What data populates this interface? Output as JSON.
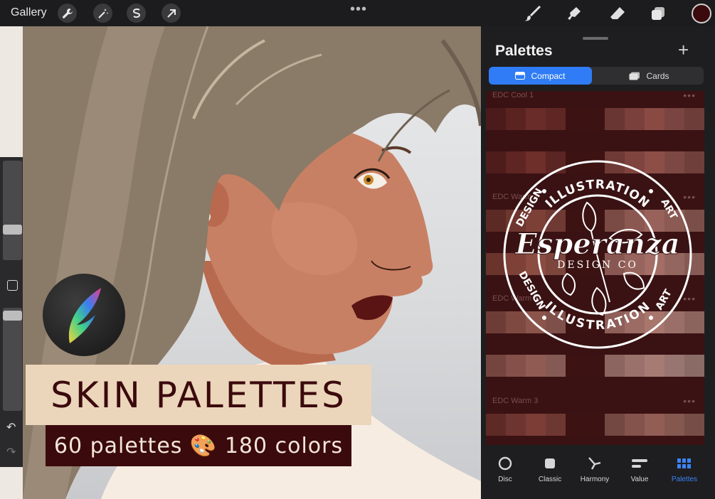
{
  "topbar": {
    "gallery_label": "Gallery",
    "more": "•••",
    "left_tools": [
      "wrench-icon",
      "magic-wand-icon",
      "selection-icon",
      "transform-arrow-icon"
    ],
    "right_tools": [
      "brush-icon",
      "smudge-icon",
      "eraser-icon",
      "layers-icon"
    ],
    "current_color": "#3a0a0c"
  },
  "canvas": {
    "headline": "SKIN PALETTES",
    "subline": "60 palettes 🎨 180 colors"
  },
  "panel": {
    "title": "Palettes",
    "add": "+",
    "view_modes": [
      {
        "label": "Compact",
        "active": true
      },
      {
        "label": "Cards",
        "active": false
      }
    ],
    "palettes": [
      {
        "name": "EDC Cool 1",
        "dots": "•••",
        "rows": [
          [
            "#4a1b1a",
            "#5a2320",
            "#6a2c28",
            "#5e2724",
            "#3c1312",
            "#3c1312",
            "#6a3633",
            "#7a403b",
            "#8a4a44",
            "#7a4540",
            "#6d3d39"
          ],
          [
            "#4d1c1b",
            "#5f2522",
            "#6e2e2a",
            "#5a2522",
            "#3c1312",
            "#3c1312",
            "#6f3a36",
            "#80443f",
            "#8d4e48",
            "#7d4843",
            "#6f3f3b"
          ]
        ]
      },
      {
        "name": "EDC Warm 2",
        "dots": "•••",
        "rows": [
          [
            "#5b2a25",
            "#6e362f",
            "#7c4036",
            "#6e3a33",
            "#3c1312",
            "#3c1312",
            "#7a4a44",
            "#8b5751",
            "#98625a",
            "#8a5a53",
            "#7b4f49"
          ],
          [
            "#6a342d",
            "#7d4138",
            "#8b4c41",
            "#7c463d",
            "#3c1312",
            "#3c1312",
            "#885751",
            "#98655e",
            "#a36e66",
            "#946660",
            "#865b55"
          ]
        ]
      },
      {
        "name": "EDC Warm 3",
        "dots": "•••",
        "rows": [
          [
            "#6e3c36",
            "#7e4940",
            "#8c554b",
            "#7f5049",
            "#3c1312",
            "#3c1312",
            "#8e5f58",
            "#9c6b63",
            "#a8766d",
            "#9a6f68",
            "#8b645e"
          ],
          [
            "#74443e",
            "#845049",
            "#905b53",
            "#865a54",
            "#3c1312",
            "#3c1312",
            "#8c6560",
            "#9a716b",
            "#a67b74",
            "#987570",
            "#8a6b66"
          ]
        ]
      },
      {
        "name": "EDC Warm 3",
        "dots": "•••",
        "rows": [
          [
            "#5e2a26",
            "#6e342f",
            "#7c3d37",
            "#6e3832",
            "#3c1312",
            "#3c1312",
            "#744842",
            "#84534c",
            "#925d55",
            "#84574f",
            "#764d47"
          ]
        ]
      }
    ],
    "stamp": {
      "top_text": "ILLUSTRATION",
      "bottom_text": "ILLUSTRATION",
      "left_upper": "DESIGN",
      "left_lower": "DESIGN",
      "right_upper": "ART",
      "right_lower": "ART",
      "brand": "Esperanza",
      "brand_sub": "DESIGN CO"
    }
  },
  "tabs": [
    {
      "label": "Disc",
      "icon": "disc-icon",
      "active": false
    },
    {
      "label": "Classic",
      "icon": "classic-square-icon",
      "active": false
    },
    {
      "label": "Harmony",
      "icon": "harmony-icon",
      "active": false
    },
    {
      "label": "Value",
      "icon": "value-sliders-icon",
      "active": false
    },
    {
      "label": "Palettes",
      "icon": "palettes-grid-icon",
      "active": true
    }
  ]
}
